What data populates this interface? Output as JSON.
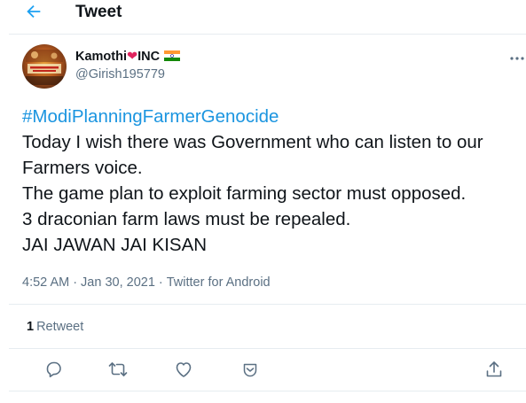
{
  "header": {
    "back_icon": "arrow-left-icon",
    "title": "Tweet"
  },
  "author": {
    "display_name": "Kamothi",
    "name_suffix": "INC",
    "handle": "@Girish195779",
    "avatar_icon": "user-avatar"
  },
  "tweet": {
    "hashtag": "#ModiPlanningFarmerGenocide",
    "lines": [
      "Today I wish there was Government who can listen to our",
      "Farmers voice.",
      "The game plan to exploit farming sector must opposed.",
      "3 draconian farm laws must be repealed.",
      "JAI JAWAN JAI KISAN"
    ]
  },
  "meta": {
    "time": "4:52 AM",
    "separator": "·",
    "date": "Jan 30, 2021",
    "source": "Twitter for Android"
  },
  "stats": {
    "retweet_count": "1",
    "retweet_label": "Retweet"
  },
  "actions": [
    "reply-icon",
    "retweet-icon",
    "like-icon",
    "bookmark-icon",
    "share-icon"
  ],
  "colors": {
    "link": "#1b95e0",
    "secondary_text": "#5b7083",
    "primary_text": "#0f1419",
    "divider": "#e6ecf0",
    "heart": "#e0245e"
  }
}
